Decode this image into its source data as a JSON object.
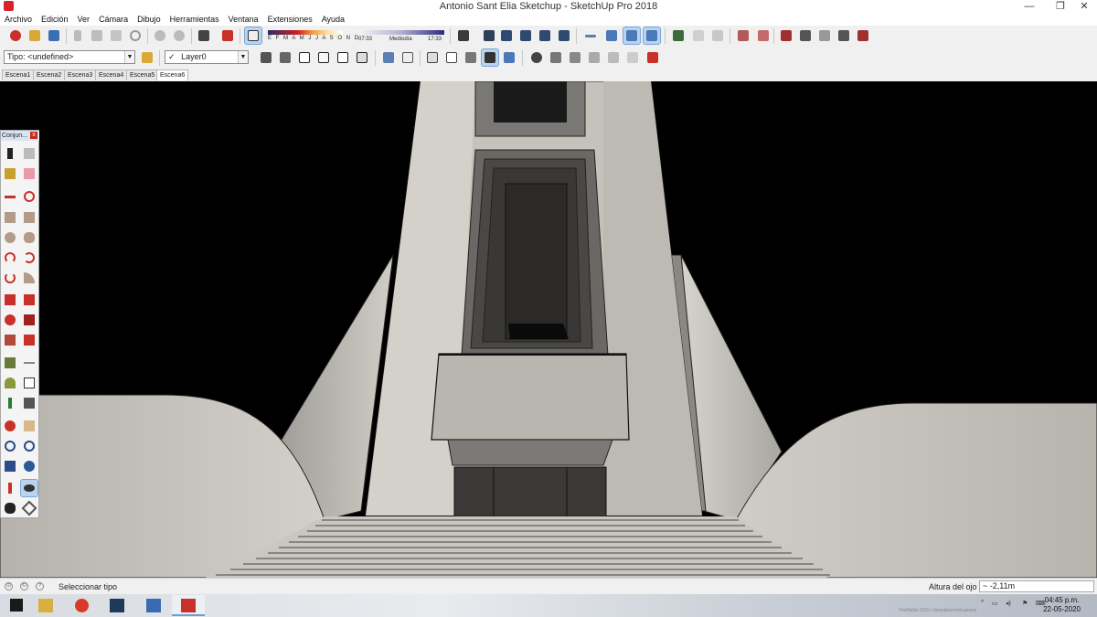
{
  "window": {
    "title": "Antonio Sant Elia Sketchup - SketchUp Pro 2018",
    "controls": [
      "—",
      "❐",
      "✕"
    ]
  },
  "menu": [
    "Archivo",
    "Edición",
    "Ver",
    "Cámara",
    "Dibujo",
    "Herramientas",
    "Ventana",
    "Extensiones",
    "Ayuda"
  ],
  "shadows": {
    "months": "E F M A M J J A S O N D",
    "time_start": "07:33",
    "time_mid": "Mediodía",
    "time_end": "17:33"
  },
  "toolbar2": {
    "type_dropdown": "Tipo: <undefined>",
    "layer_check": "✓",
    "layer_dropdown": "Layer0"
  },
  "scenes": [
    "Escena1",
    "Escena2",
    "Escena3",
    "Escena4",
    "Escena5",
    "Escena6"
  ],
  "active_scene": "Escena6",
  "tool_panel": {
    "title": "Conjun...",
    "close": "x",
    "tools": [
      "select",
      "paint-bucket",
      "component",
      "eraser",
      "line",
      "freehand",
      "rectangle",
      "rotated-rectangle",
      "circle",
      "polygon",
      "arc",
      "two-point-arc",
      "three-point-arc",
      "pie",
      "move",
      "push-pull",
      "rotate",
      "follow-me",
      "scale",
      "offset",
      "tape-measure",
      "dimension",
      "protractor",
      "text",
      "axes",
      "3d-text",
      "orbit",
      "pan",
      "zoom",
      "zoom-window",
      "zoom-extents",
      "previous-view",
      "position-camera",
      "look-around",
      "walk",
      "section-plane"
    ],
    "selected": "look-around"
  },
  "status": {
    "message": "Seleccionar tipo",
    "vcb_label": "Altura del ojo",
    "vcb_value": "~ -2,11m"
  },
  "taskbar": {
    "apps": [
      "windows-start",
      "file-explorer",
      "chrome",
      "desktop-app",
      "network-app",
      "sketchup"
    ],
    "clock_time": "04:45 p.m.",
    "clock_date": "22-05-2020",
    "watermark": "TimWalks 2015 / timwalkscom/camera"
  },
  "colors": {
    "accent": "#b8d4ee",
    "sky": "#000000",
    "concrete": "#c6c4bc",
    "sketchup_red": "#d8232a"
  }
}
